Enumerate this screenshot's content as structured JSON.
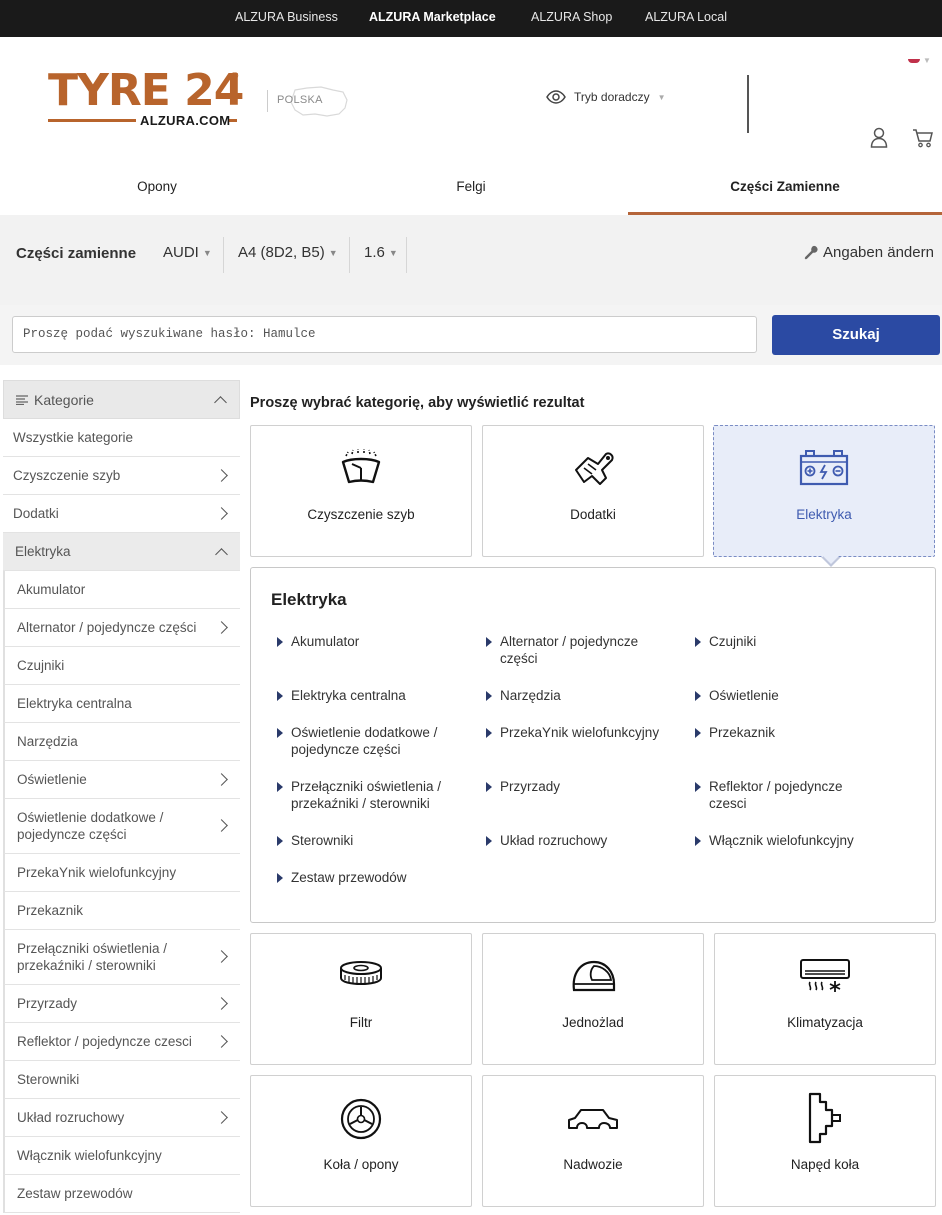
{
  "topbar": {
    "links": [
      "ALZURA Business",
      "ALZURA Marketplace",
      "ALZURA Shop",
      "ALZURA Local"
    ]
  },
  "header": {
    "logo_main": "TYRE 24",
    "logo_reg": "®",
    "logo_sub": "ALZURA.COM",
    "country": "POLSKA",
    "advisor_mode": "Tryb doradczy"
  },
  "main_tabs": [
    "Opony",
    "Felgi",
    "Części Zamienne"
  ],
  "vehicle": {
    "title": "Części zamienne",
    "make": "AUDI",
    "model": "A4 (8D2, B5)",
    "engine": "1.6",
    "change_label": "Angaben ändern"
  },
  "search": {
    "placeholder": "Proszę podać wyszukiwane hasło: Hamulce",
    "button": "Szukaj"
  },
  "sidebar": {
    "header": "Kategorie",
    "items": [
      "Wszystkie kategorie",
      "Czyszczenie szyb",
      "Dodatki",
      "Elektryka",
      "Akumulator",
      "Alternator / pojedyncze części",
      "Czujniki",
      "Elektryka centralna",
      "Narzędzia",
      "Oświetlenie",
      "Oświetlenie dodatkowe / pojedyncze części",
      "PrzekaYnik wielofunkcyjny",
      "Przekaznik",
      "Przełączniki oświetlenia / przekaźniki / sterowniki",
      "Przyrzady",
      "Reflektor / pojedyncze czesci",
      "Sterowniki",
      "Układ rozruchowy",
      "Włącznik wielofunkcyjny",
      "Zestaw przewodów"
    ]
  },
  "content": {
    "prompt": "Proszę wybrać kategorię, aby wyświetlić rezultat",
    "cards": [
      {
        "label": "Czyszczenie szyb",
        "icon": "windshield-wiper-icon"
      },
      {
        "label": "Dodatki",
        "icon": "accessories-icon"
      },
      {
        "label": "Elektryka",
        "icon": "car-battery-icon"
      },
      {
        "label": "Filtr",
        "icon": "filter-icon"
      },
      {
        "label": "Jednożlad",
        "icon": "helmet-icon"
      },
      {
        "label": "Klimatyzacja",
        "icon": "air-conditioning-icon"
      },
      {
        "label": "Koła / opony",
        "icon": "wheel-icon"
      },
      {
        "label": "Nadwozie",
        "icon": "car-body-icon"
      },
      {
        "label": "Napęd koła",
        "icon": "wheel-drive-icon"
      }
    ],
    "panel": {
      "title": "Elektryka",
      "links": [
        "Akumulator",
        "Alternator / pojedyncze części",
        "Czujniki",
        "Elektryka centralna",
        "Narzędzia",
        "Oświetlenie",
        "Oświetlenie dodatkowe / pojedyncze części",
        "PrzekaYnik wielofunkcyjny",
        "Przekaznik",
        "Przełączniki oświetlenia / przekaźniki / sterowniki",
        "Przyrzady",
        "Reflektor / pojedyncze czesci",
        "Sterowniki",
        "Układ rozruchowy",
        "Włącznik wielofunkcyjny",
        "Zestaw przewodów"
      ]
    }
  },
  "colors": {
    "brand": "#b8642c",
    "accent_blue": "#2b4aa3",
    "selected_bg": "#e8edf9"
  }
}
